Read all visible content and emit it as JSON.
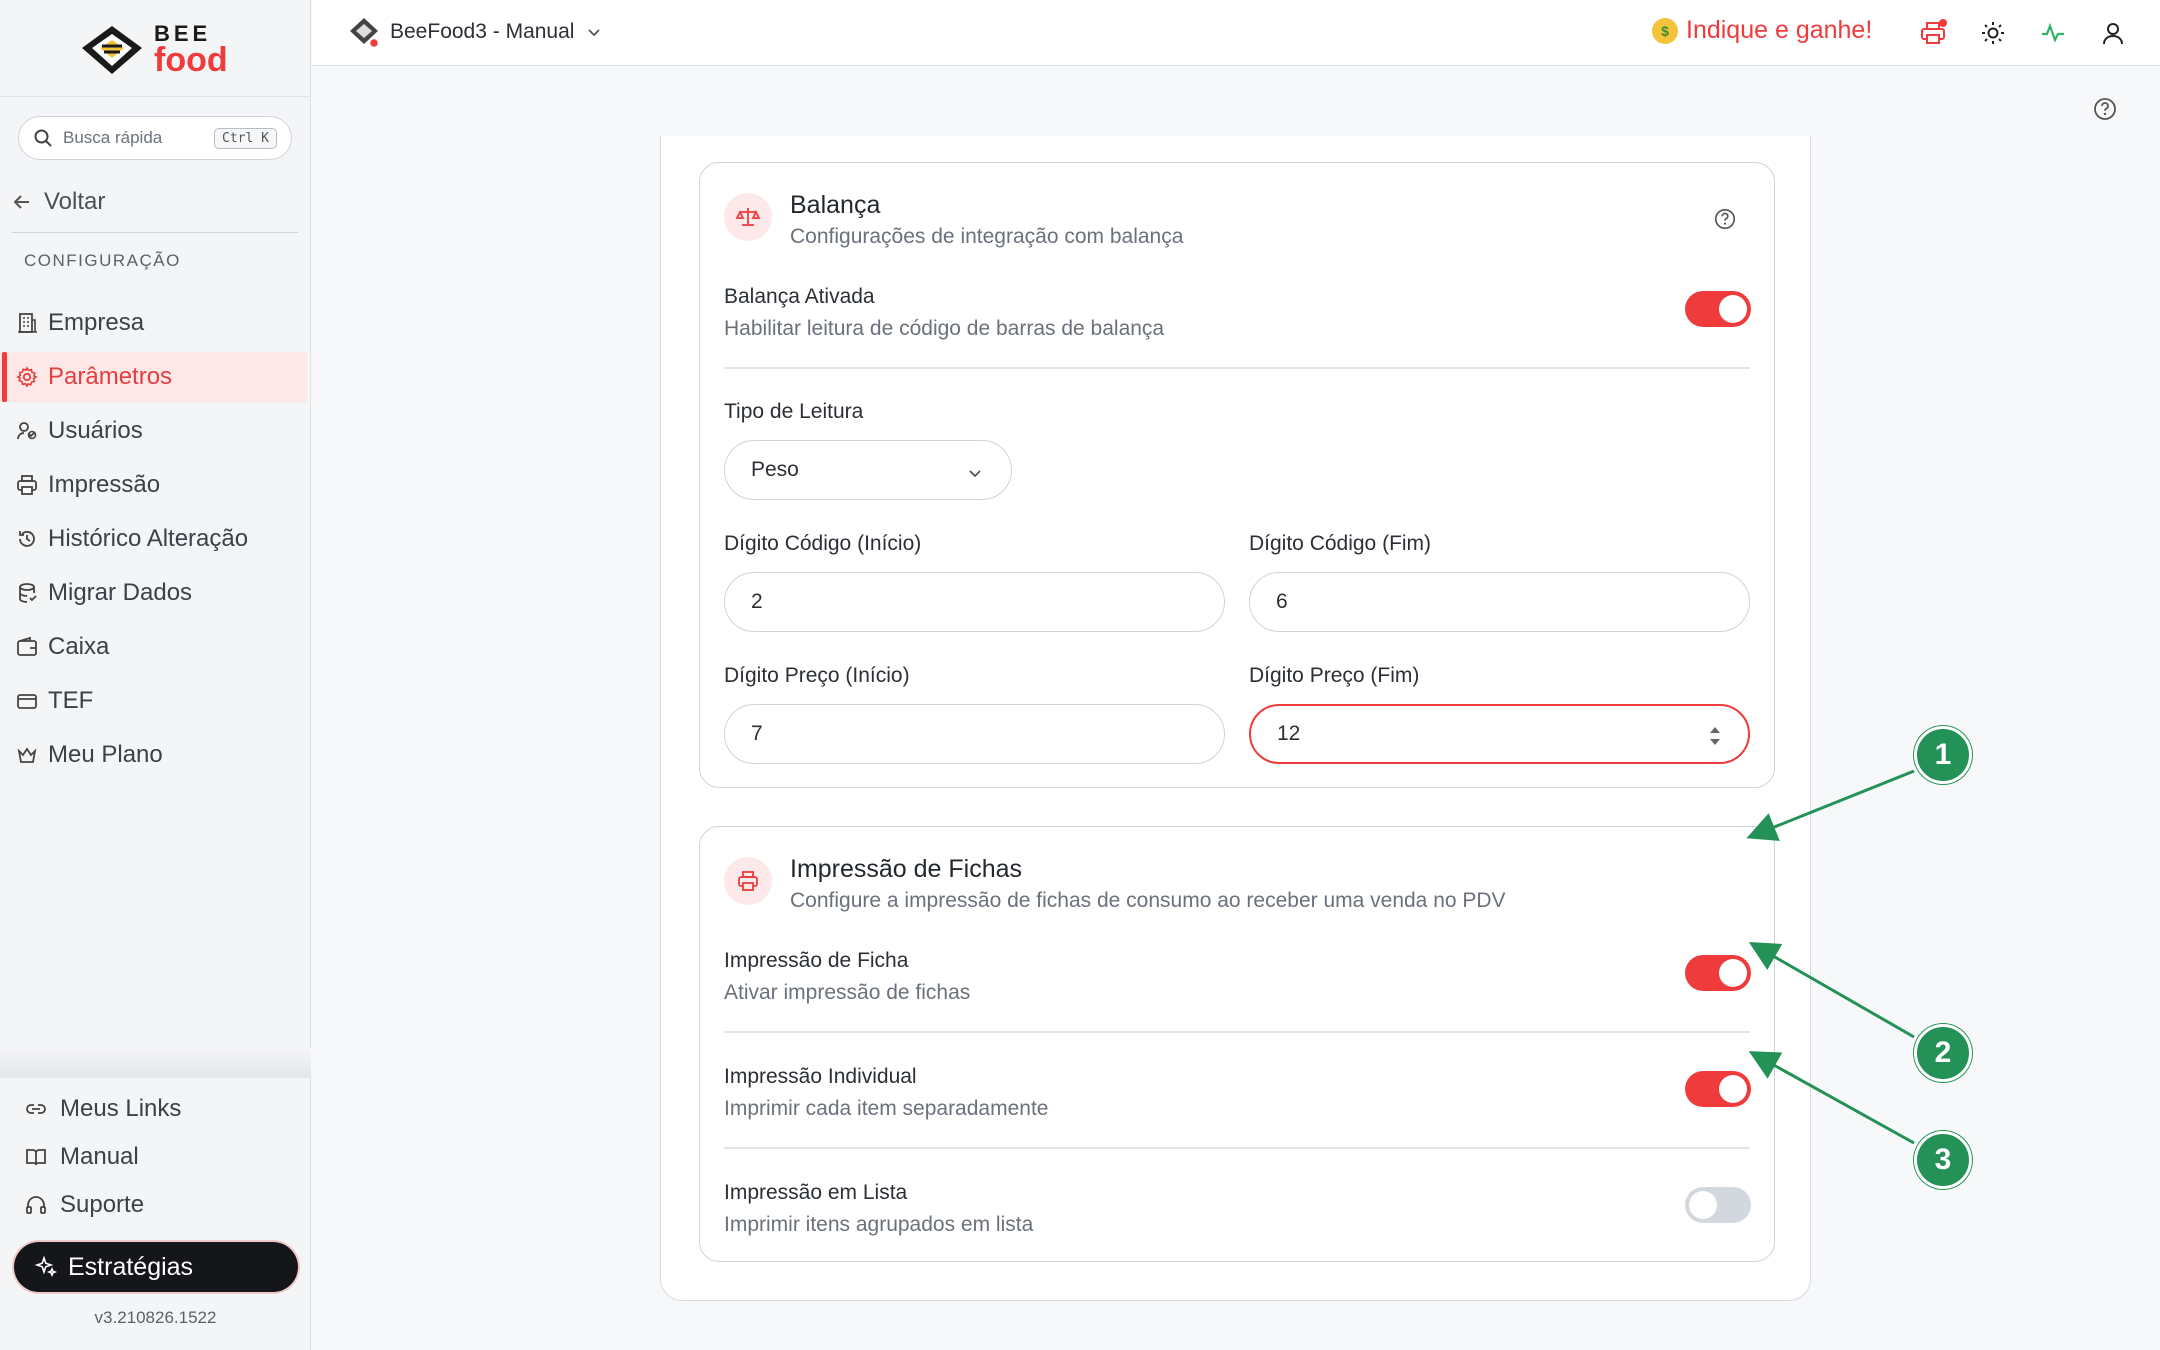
{
  "brand": {
    "line1": "BEE",
    "line2": "food"
  },
  "search": {
    "placeholder": "Busca rápida",
    "shortcut": "Ctrl K"
  },
  "sidebar": {
    "back_label": "Voltar",
    "section_title": "CONFIGURAÇÃO",
    "items": [
      {
        "label": "Empresa",
        "icon": "building-icon"
      },
      {
        "label": "Parâmetros",
        "icon": "gear-icon",
        "active": true
      },
      {
        "label": "Usuários",
        "icon": "users-icon"
      },
      {
        "label": "Impressão",
        "icon": "printer-icon"
      },
      {
        "label": "Histórico Alteração",
        "icon": "history-icon"
      },
      {
        "label": "Migrar Dados",
        "icon": "database-icon"
      },
      {
        "label": "Caixa",
        "icon": "wallet-icon"
      },
      {
        "label": "TEF",
        "icon": "card-icon"
      },
      {
        "label": "Meu Plano",
        "icon": "crown-icon"
      }
    ],
    "bottom_links": [
      {
        "label": "Meus Links",
        "icon": "link-icon"
      },
      {
        "label": "Manual",
        "icon": "book-icon"
      },
      {
        "label": "Suporte",
        "icon": "headset-icon"
      }
    ],
    "strategies_label": "Estratégias",
    "version": "v3.210826.1522"
  },
  "topbar": {
    "store_name": "BeeFood3 - Manual",
    "refer_label": "Indique e ganhe!"
  },
  "balanca": {
    "title": "Balança",
    "subtitle": "Configurações de integração com balança",
    "enabled_label": "Balança Ativada",
    "enabled_desc": "Habilitar leitura de código de barras de balança",
    "enabled": true,
    "reading_type_label": "Tipo de Leitura",
    "reading_type_value": "Peso",
    "code_start_label": "Dígito Código (Início)",
    "code_start_value": "2",
    "code_end_label": "Dígito Código (Fim)",
    "code_end_value": "6",
    "price_start_label": "Dígito Preço (Início)",
    "price_start_value": "7",
    "price_end_label": "Dígito Preço (Fim)",
    "price_end_value": "12"
  },
  "fichas": {
    "title": "Impressão de Fichas",
    "subtitle": "Configure a impressão de fichas de consumo ao receber uma venda no PDV",
    "options": [
      {
        "label": "Impressão de Ficha",
        "desc": "Ativar impressão de fichas",
        "on": true
      },
      {
        "label": "Impressão Individual",
        "desc": "Imprimir cada item separadamente",
        "on": true
      },
      {
        "label": "Impressão em Lista",
        "desc": "Imprimir itens agrupados em lista",
        "on": false
      }
    ]
  },
  "annotations": [
    "1",
    "2",
    "3"
  ],
  "colors": {
    "accent": "#ef3b3b",
    "annotation": "#249257"
  }
}
